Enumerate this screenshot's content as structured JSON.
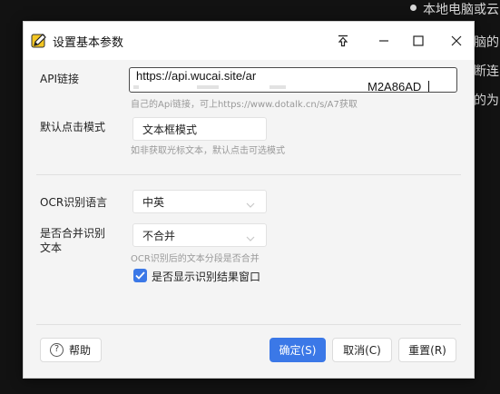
{
  "background": {
    "lines": [
      "本地电脑或云",
      "脑的",
      "断连",
      "的为"
    ]
  },
  "window": {
    "title": "设置基本参数",
    "controls": {
      "pin": "pin-icon",
      "minimize": "minimize-icon",
      "maximize": "maximize-icon",
      "close": "close-icon"
    }
  },
  "api": {
    "label": "API链接",
    "value_line1": "https://api.wucai.site/ar",
    "value_line2_suffix": "M2A86AD",
    "hint": "自己的Api链接，可上https://www.dotalk.cn/s/A7获取"
  },
  "click_mode": {
    "label": "默认点击模式",
    "selected": "文本框模式",
    "hint": "如非获取光标文本，默认点击可选模式"
  },
  "ocr_language": {
    "label": "OCR识别语言",
    "selected": "中英"
  },
  "merge_text": {
    "label": "是否合并识别文本",
    "selected": "不合并",
    "hint": "OCR识别后的文本分段是否合并"
  },
  "show_result": {
    "label": "是否显示识别结果窗口",
    "checked": true
  },
  "buttons": {
    "help": "帮助",
    "ok": "确定(S)",
    "cancel": "取消(C)",
    "reset": "重置(R)"
  },
  "colors": {
    "accent": "#3b78e7",
    "dialog_bg": "#f4f4f4",
    "page_bg": "#121212"
  }
}
